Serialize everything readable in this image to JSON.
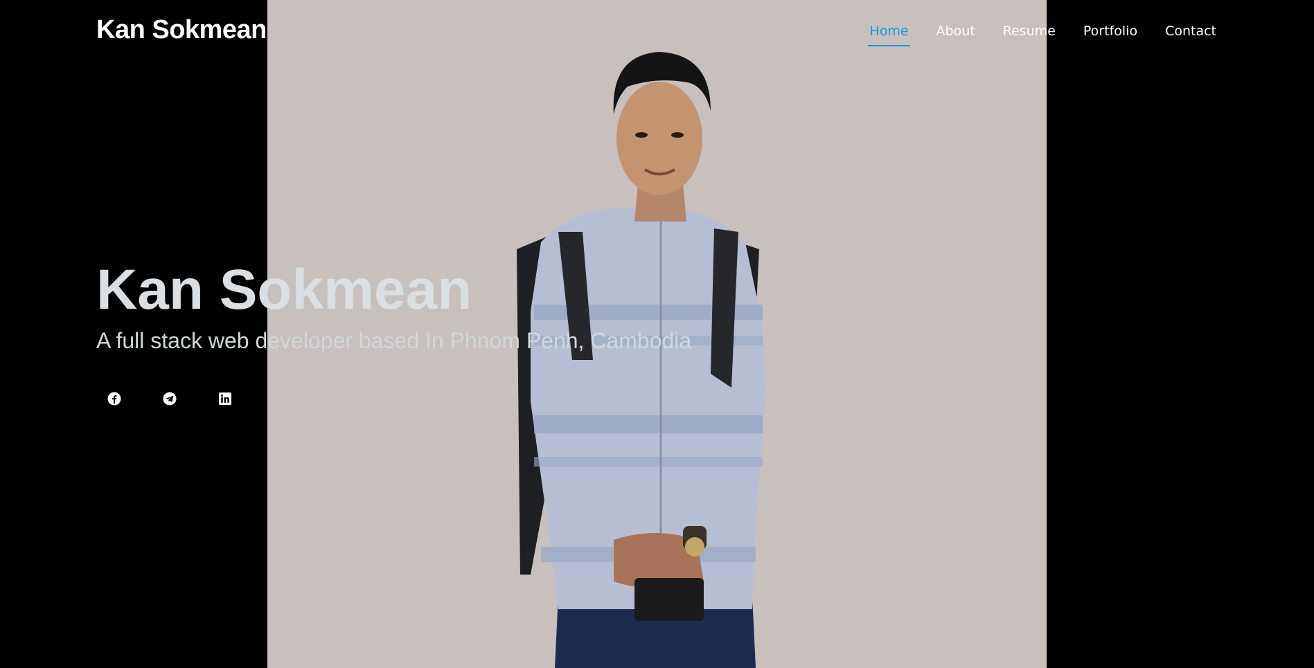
{
  "header": {
    "logo_text": "Kan Sokmean",
    "nav": [
      {
        "label": "Home",
        "active": true
      },
      {
        "label": "About",
        "active": false
      },
      {
        "label": "Resume",
        "active": false
      },
      {
        "label": "Portfolio",
        "active": false
      },
      {
        "label": "Contact",
        "active": false
      }
    ]
  },
  "hero": {
    "title": "Kan Sokmean",
    "subtitle": "A full stack web developer based In Phnom Penh, Cambodia",
    "photo_description_icon": "portrait-photo"
  },
  "social": [
    {
      "icon": "facebook-icon"
    },
    {
      "icon": "telegram-icon"
    },
    {
      "icon": "linkedin-icon"
    }
  ],
  "colors": {
    "accent": "#149ddd",
    "background": "#000000",
    "photo_background": "#c8c0bd",
    "text": "#ffffff"
  }
}
